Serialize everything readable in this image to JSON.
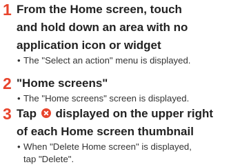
{
  "steps": [
    {
      "number": "1",
      "instruction_lines": [
        "From the Home screen, touch",
        "and hold down an area with no",
        "application icon or widget"
      ],
      "note_lines": [
        "The \"Select an action\" menu is displayed."
      ]
    },
    {
      "number": "2",
      "instruction_lines": [
        "\"Home screens\""
      ],
      "note_lines": [
        "The \"Home screens\" screen is displayed."
      ]
    },
    {
      "number": "3",
      "instruction_lines": [
        "Tap",
        "displayed on the upper right",
        "of each Home screen thumbnail"
      ],
      "note_lines": [
        "When \"Delete Home screen\" is displayed,",
        "tap \"Delete\"."
      ]
    }
  ],
  "bullet": "•",
  "icons": {
    "delete": "delete-circle-icon",
    "delete_color": "#e8442c"
  },
  "accent_color": "#e8442c"
}
